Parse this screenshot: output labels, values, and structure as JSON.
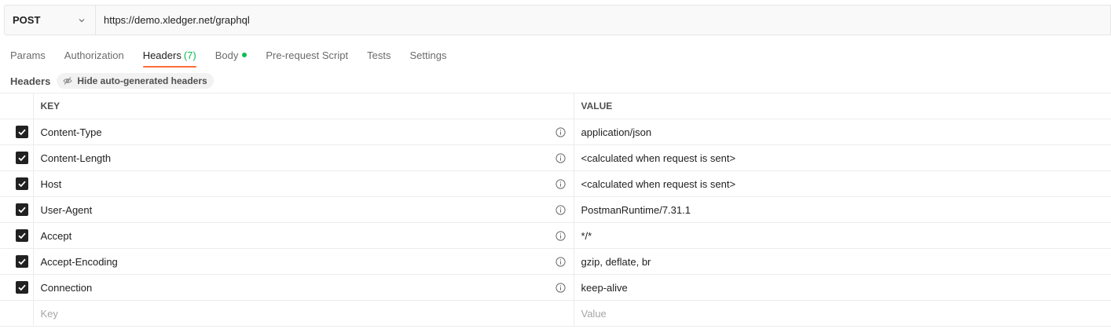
{
  "request": {
    "method": "POST",
    "url": "https://demo.xledger.net/graphql"
  },
  "tabs": [
    {
      "label": "Params"
    },
    {
      "label": "Authorization"
    },
    {
      "label": "Headers",
      "count": "(7)"
    },
    {
      "label": "Body"
    },
    {
      "label": "Pre-request Script"
    },
    {
      "label": "Tests"
    },
    {
      "label": "Settings"
    }
  ],
  "headers_section": {
    "label": "Headers",
    "hide_button": "Hide auto-generated headers"
  },
  "table": {
    "key_header": "KEY",
    "value_header": "VALUE",
    "rows": [
      {
        "key": "Content-Type",
        "value": "application/json"
      },
      {
        "key": "Content-Length",
        "value": "<calculated when request is sent>"
      },
      {
        "key": "Host",
        "value": "<calculated when request is sent>"
      },
      {
        "key": "User-Agent",
        "value": "PostmanRuntime/7.31.1"
      },
      {
        "key": "Accept",
        "value": "*/*"
      },
      {
        "key": "Accept-Encoding",
        "value": "gzip, deflate, br"
      },
      {
        "key": "Connection",
        "value": "keep-alive"
      }
    ],
    "new_key_placeholder": "Key",
    "new_value_placeholder": "Value"
  },
  "colors": {
    "accent": "#ff6c37",
    "success": "#0cbb52"
  }
}
